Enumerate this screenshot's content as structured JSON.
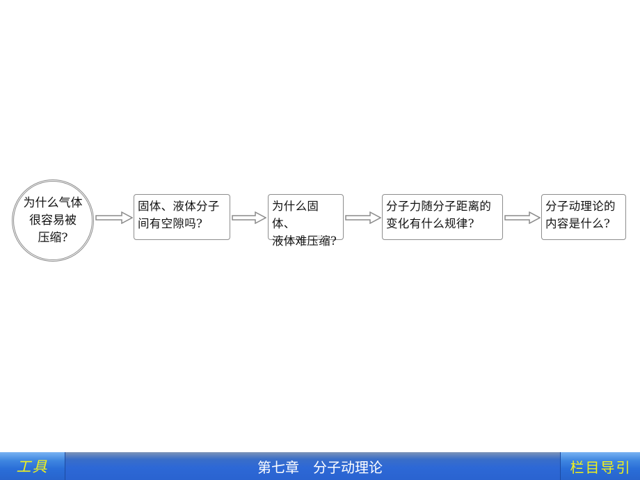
{
  "diagram": {
    "type": "flowchart",
    "start_node": {
      "lines": [
        "为什么气体",
        "很容易被",
        "压缩?"
      ]
    },
    "nodes": [
      {
        "lines": [
          "固体、液体分子",
          "间有空隙吗?"
        ]
      },
      {
        "lines": [
          "为什么固体、",
          "液体难压缩?"
        ]
      },
      {
        "lines": [
          "分子力随分子距离的",
          "变化有什么规律?"
        ]
      },
      {
        "lines": [
          "分子动理论的",
          "内容是什么?"
        ]
      }
    ],
    "edges": [
      {
        "from": "start",
        "to": "node-1"
      },
      {
        "from": "node-1",
        "to": "node-2"
      },
      {
        "from": "node-2",
        "to": "node-3"
      },
      {
        "from": "node-3",
        "to": "node-4"
      }
    ]
  },
  "footer": {
    "tool_button": "工具",
    "chapter_title": "第七章　分子动理论",
    "nav_button": "栏目导引",
    "colors": {
      "bar": "#2a63d0",
      "button_text": "#f2f21a",
      "title_text": "#ffffff"
    }
  }
}
